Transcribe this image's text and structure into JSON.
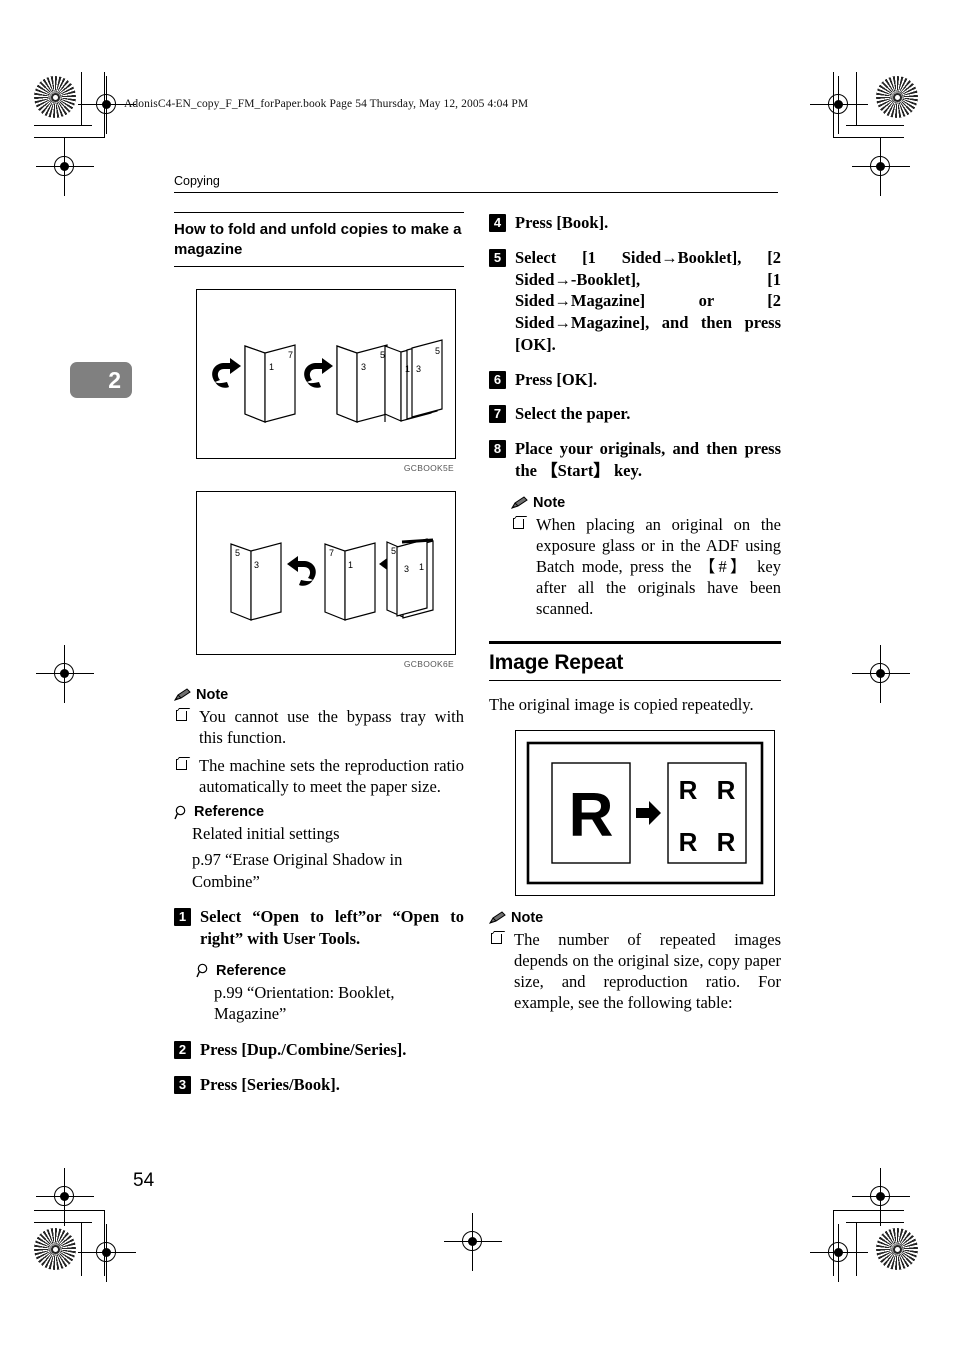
{
  "document": {
    "book_header": "AdonisC4-EN_copy_F_FM_forPaper.book  Page 54  Thursday, May 12, 2005  4:04 PM",
    "running_head": "Copying",
    "chapter_tab": "2",
    "page_number": "54"
  },
  "left_column": {
    "subheading": "How to fold and unfold copies to make a magazine",
    "figure1_caption": "GCBOOK5E",
    "figure2_caption": "GCBOOK6E",
    "note": {
      "title": "Note",
      "items": [
        "You cannot use the bypass tray with this function.",
        "The machine sets the reproduction ratio automatically to meet the paper size."
      ]
    },
    "reference": {
      "title": "Reference",
      "line1": "Related initial settings",
      "line2": "p.97 “Erase Original Shadow in Combine”"
    },
    "steps": [
      {
        "num": "1",
        "text": "Select “Open to left”or “Open to right” with User Tools.",
        "reference": {
          "title": "Reference",
          "line1": "p.99 “Orientation: Booklet, Magazine”"
        }
      },
      {
        "num": "2",
        "text": "Press [Dup./Combine/Series]."
      },
      {
        "num": "3",
        "text": "Press [Series/Book]."
      }
    ]
  },
  "right_column": {
    "steps": [
      {
        "num": "4",
        "text": "Press [Book]."
      },
      {
        "num": "5",
        "text": "Select [1 Sided→Booklet], [2 Sided→-Booklet], [1 Sided→Magazine] or [2 Sided→Magazine], and then press [OK]."
      },
      {
        "num": "6",
        "text": "Press [OK]."
      },
      {
        "num": "7",
        "text": "Select the paper."
      },
      {
        "num": "8",
        "text": "Place your originals, and then press the 【Start】 key."
      }
    ],
    "note_after_steps": {
      "title": "Note",
      "items": [
        "When placing an original on the exposure glass or in the ADF using Batch mode, press the 【#】 key after all the originals have been scanned."
      ]
    },
    "section": {
      "heading": "Image Repeat",
      "intro": "The original image is copied repeatedly."
    },
    "figure_image_repeat": {
      "original_letter": "R",
      "repeated_letters": [
        "R",
        "R",
        "R",
        "R"
      ]
    },
    "note_final": {
      "title": "Note",
      "items": [
        "The number of repeated images depends on the original size, copy paper size, and reproduction ratio. For example, see the following table:"
      ]
    }
  },
  "figures": {
    "booklet_left_open": {
      "sheets": [
        {
          "front": "7",
          "inner": "1"
        },
        {
          "front": "5",
          "inner": "3"
        }
      ],
      "result": {
        "labels": [
          "1",
          "3",
          "5"
        ]
      }
    },
    "booklet_right_open": {
      "sheets": [
        {
          "front": "5",
          "inner": "3"
        },
        {
          "front": "7",
          "inner": "1"
        }
      ],
      "result": {
        "labels": [
          "5",
          "3",
          "1"
        ]
      }
    }
  }
}
